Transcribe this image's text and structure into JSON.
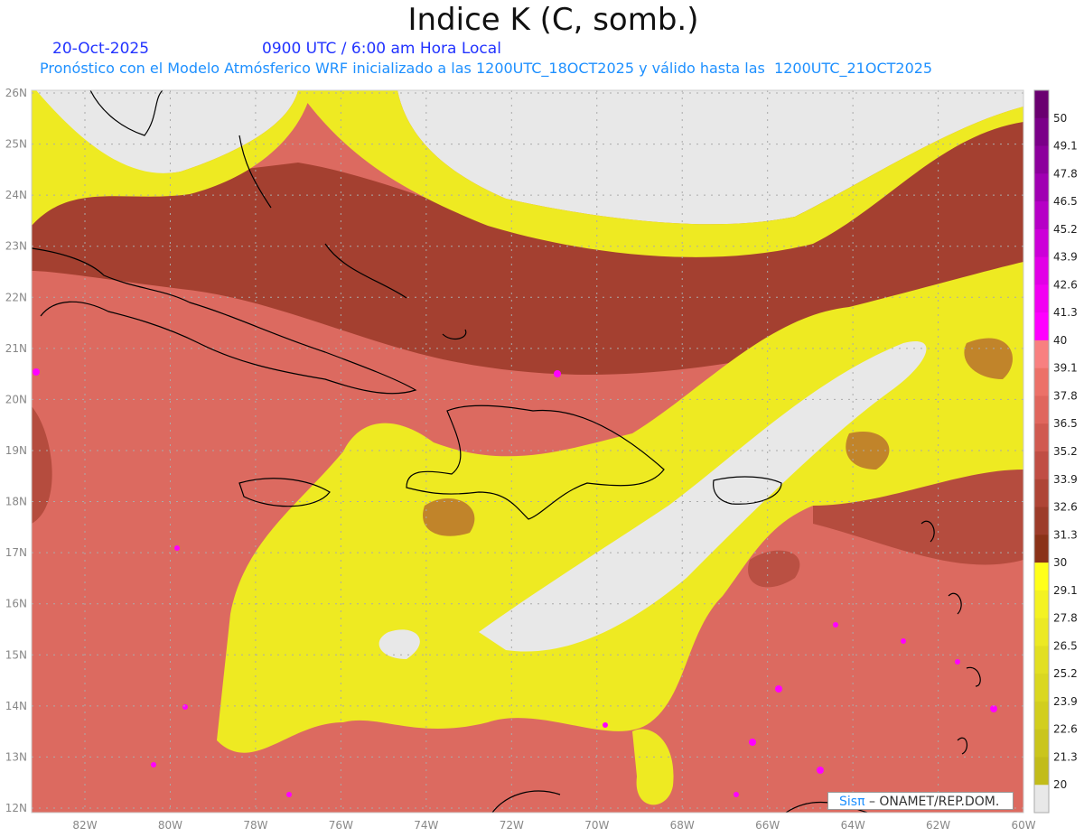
{
  "header": {
    "title": "Indice K (C, somb.)",
    "date": "20-Oct-2025",
    "time": "0900 UTC / 6:00 am Hora Local",
    "subtitle": "Pronóstico con el Modelo Atmósferico WRF inicializado a las 1200UTC_18OCT2025 y válido hasta las  1200UTC_21OCT2025"
  },
  "map": {
    "lon_range": [
      -83.1,
      -60
    ],
    "lat_range": [
      12,
      26
    ],
    "lat_labels": [
      "12N",
      "13N",
      "14N",
      "15N",
      "16N",
      "17N",
      "18N",
      "19N",
      "20N",
      "21N",
      "22N",
      "23N",
      "24N",
      "25N",
      "26N"
    ],
    "lon_labels": [
      "82W",
      "80W",
      "78W",
      "76W",
      "74W",
      "72W",
      "70W",
      "68W",
      "66W",
      "64W",
      "62W",
      "60W"
    ]
  },
  "colorbar": {
    "labels": [
      "50",
      "49.1",
      "47.8",
      "46.5",
      "45.2",
      "43.9",
      "42.6",
      "41.3",
      "40",
      "39.1",
      "37.8",
      "36.5",
      "35.2",
      "33.9",
      "32.6",
      "31.3",
      "30",
      "29.1",
      "27.8",
      "26.5",
      "25.2",
      "23.9",
      "22.6",
      "21.3",
      "20"
    ],
    "colors": [
      "#6a0070",
      "#7a0088",
      "#8c009c",
      "#a000b2",
      "#b600c6",
      "#cc00d8",
      "#e200e6",
      "#f200f2",
      "#ff00ff",
      "#f88080",
      "#ec7168",
      "#e0665d",
      "#d05a50",
      "#c04e44",
      "#ae4536",
      "#9c3c2a",
      "#8a3218",
      "#ffff1a",
      "#f4f222",
      "#ece924",
      "#e2df22",
      "#dad720",
      "#d2ce1e",
      "#cac51c",
      "#c2bc1a",
      "#e8e8e8"
    ]
  },
  "credit": {
    "brand": "Sisπ",
    "text": " –  ONAMET/REP.DOM."
  },
  "colors": {
    "base": "#dc6a60",
    "dark": "#a44030",
    "yellow": "#eeea22",
    "gray": "#e8e8e8",
    "magenta": "#ff00ff"
  }
}
